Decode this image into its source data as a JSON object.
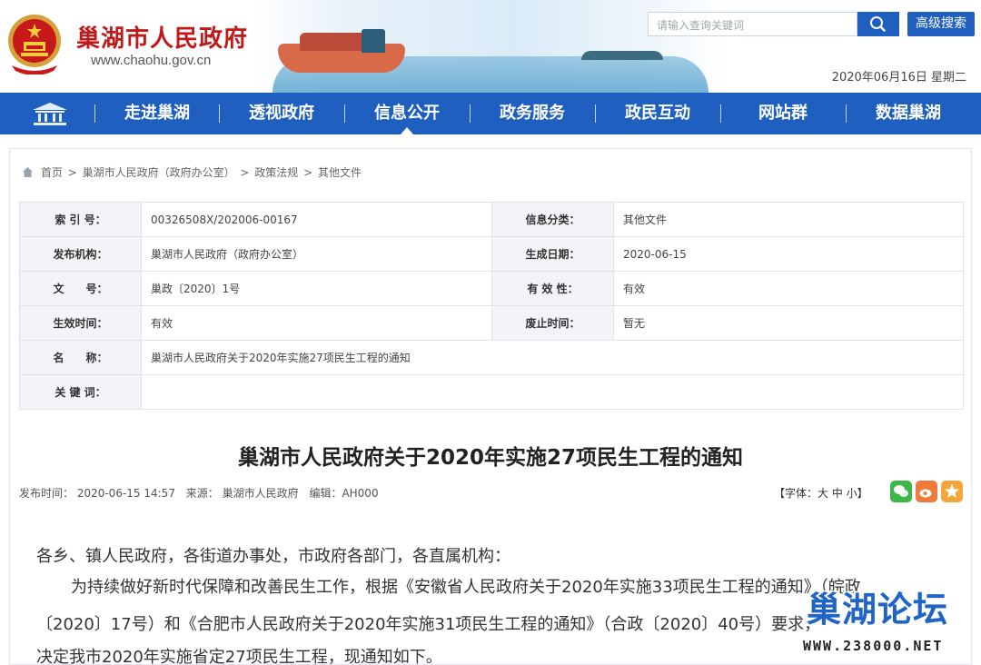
{
  "header": {
    "title": "巢湖市人民政府",
    "url": "www.chaohu.gov.cn",
    "search_placeholder": "请输入查询关键词",
    "advanced_search": "高级搜索",
    "date": "2020年06月16日 星期二"
  },
  "nav": {
    "items": [
      "走进巢湖",
      "透视政府",
      "信息公开",
      "政务服务",
      "政民互动",
      "网站群",
      "数据巢湖"
    ],
    "active": "信息公开"
  },
  "breadcrumb": [
    "首页",
    "巢湖市人民政府（政府办公室）",
    "政策法规",
    "其他文件"
  ],
  "meta": {
    "index_label": "索 引 号：",
    "index_value": "00326508X/202006-00167",
    "category_label": "信息分类：",
    "category_value": "其他文件",
    "publisher_label": "发布机构：",
    "publisher_value": "巢湖市人民政府（政府办公室）",
    "created_label": "生成日期：",
    "created_value": "2020-06-15",
    "docno_label": "文　　号：",
    "docno_value": "巢政〔2020〕1号",
    "validity_label": "有 效 性：",
    "validity_value": "有效",
    "effective_label": "生效时间：",
    "effective_value": "有效",
    "abolish_label": "废止时间：",
    "abolish_value": "暂无",
    "name_label": "名　　称：",
    "name_value": "巢湖市人民政府关于2020年实施27项民生工程的通知",
    "keywords_label": "关 键 词：",
    "keywords_value": ""
  },
  "article": {
    "title": "巢湖市人民政府关于2020年实施27项民生工程的通知",
    "publish_time": "发布时间：  2020-06-15 14:57",
    "source": "来源：  巢湖市人民政府",
    "editor": "编辑：AH000",
    "font_size": "【字体：大  中  小】",
    "paragraphs": [
      "各乡、镇人民政府，各街道办事处，市政府各部门，各直属机构：",
      "为持续做好新时代保障和改善民生工作，根据《安徽省人民政府关于2020年实施33项民生工程的通知》（皖政",
      "〔2020〕17号）和《合肥市人民政府关于2020年实施31项民生工程的通知》（合政〔2020〕40号）要求，",
      "决定我市2020年实施省定27项民生工程，现通知如下。"
    ]
  },
  "watermark": {
    "title": "巢湖论坛",
    "url": "WWW.238000.NET"
  },
  "colors": {
    "nav_blue": "#1f5fbf",
    "title_red": "#c0191a",
    "watermark_blue": "#1f64c6"
  }
}
